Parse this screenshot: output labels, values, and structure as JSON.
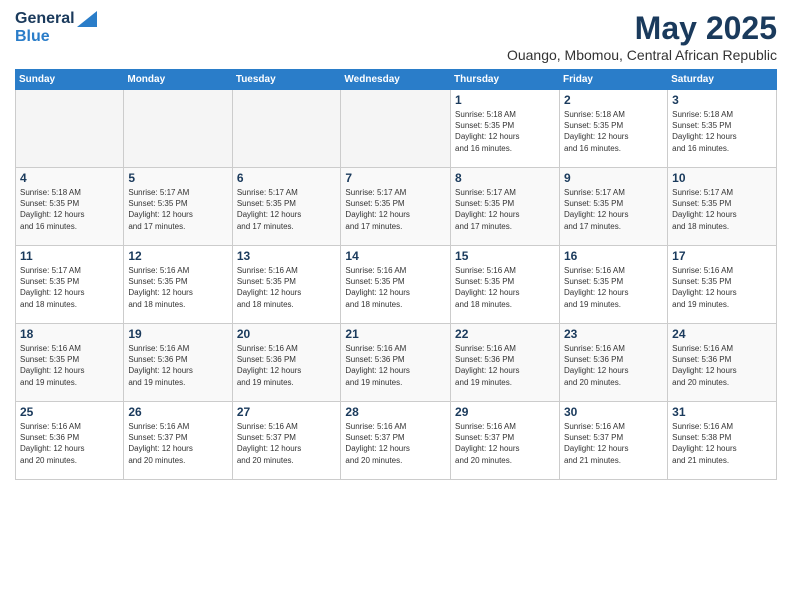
{
  "logo": {
    "general": "General",
    "blue": "Blue"
  },
  "header": {
    "month": "May 2025",
    "subtitle": "Ouango, Mbomou, Central African Republic"
  },
  "weekdays": [
    "Sunday",
    "Monday",
    "Tuesday",
    "Wednesday",
    "Thursday",
    "Friday",
    "Saturday"
  ],
  "weeks": [
    [
      {
        "day": "",
        "info": ""
      },
      {
        "day": "",
        "info": ""
      },
      {
        "day": "",
        "info": ""
      },
      {
        "day": "",
        "info": ""
      },
      {
        "day": "1",
        "info": "Sunrise: 5:18 AM\nSunset: 5:35 PM\nDaylight: 12 hours\nand 16 minutes."
      },
      {
        "day": "2",
        "info": "Sunrise: 5:18 AM\nSunset: 5:35 PM\nDaylight: 12 hours\nand 16 minutes."
      },
      {
        "day": "3",
        "info": "Sunrise: 5:18 AM\nSunset: 5:35 PM\nDaylight: 12 hours\nand 16 minutes."
      }
    ],
    [
      {
        "day": "4",
        "info": "Sunrise: 5:18 AM\nSunset: 5:35 PM\nDaylight: 12 hours\nand 16 minutes."
      },
      {
        "day": "5",
        "info": "Sunrise: 5:17 AM\nSunset: 5:35 PM\nDaylight: 12 hours\nand 17 minutes."
      },
      {
        "day": "6",
        "info": "Sunrise: 5:17 AM\nSunset: 5:35 PM\nDaylight: 12 hours\nand 17 minutes."
      },
      {
        "day": "7",
        "info": "Sunrise: 5:17 AM\nSunset: 5:35 PM\nDaylight: 12 hours\nand 17 minutes."
      },
      {
        "day": "8",
        "info": "Sunrise: 5:17 AM\nSunset: 5:35 PM\nDaylight: 12 hours\nand 17 minutes."
      },
      {
        "day": "9",
        "info": "Sunrise: 5:17 AM\nSunset: 5:35 PM\nDaylight: 12 hours\nand 17 minutes."
      },
      {
        "day": "10",
        "info": "Sunrise: 5:17 AM\nSunset: 5:35 PM\nDaylight: 12 hours\nand 18 minutes."
      }
    ],
    [
      {
        "day": "11",
        "info": "Sunrise: 5:17 AM\nSunset: 5:35 PM\nDaylight: 12 hours\nand 18 minutes."
      },
      {
        "day": "12",
        "info": "Sunrise: 5:16 AM\nSunset: 5:35 PM\nDaylight: 12 hours\nand 18 minutes."
      },
      {
        "day": "13",
        "info": "Sunrise: 5:16 AM\nSunset: 5:35 PM\nDaylight: 12 hours\nand 18 minutes."
      },
      {
        "day": "14",
        "info": "Sunrise: 5:16 AM\nSunset: 5:35 PM\nDaylight: 12 hours\nand 18 minutes."
      },
      {
        "day": "15",
        "info": "Sunrise: 5:16 AM\nSunset: 5:35 PM\nDaylight: 12 hours\nand 18 minutes."
      },
      {
        "day": "16",
        "info": "Sunrise: 5:16 AM\nSunset: 5:35 PM\nDaylight: 12 hours\nand 19 minutes."
      },
      {
        "day": "17",
        "info": "Sunrise: 5:16 AM\nSunset: 5:35 PM\nDaylight: 12 hours\nand 19 minutes."
      }
    ],
    [
      {
        "day": "18",
        "info": "Sunrise: 5:16 AM\nSunset: 5:35 PM\nDaylight: 12 hours\nand 19 minutes."
      },
      {
        "day": "19",
        "info": "Sunrise: 5:16 AM\nSunset: 5:36 PM\nDaylight: 12 hours\nand 19 minutes."
      },
      {
        "day": "20",
        "info": "Sunrise: 5:16 AM\nSunset: 5:36 PM\nDaylight: 12 hours\nand 19 minutes."
      },
      {
        "day": "21",
        "info": "Sunrise: 5:16 AM\nSunset: 5:36 PM\nDaylight: 12 hours\nand 19 minutes."
      },
      {
        "day": "22",
        "info": "Sunrise: 5:16 AM\nSunset: 5:36 PM\nDaylight: 12 hours\nand 19 minutes."
      },
      {
        "day": "23",
        "info": "Sunrise: 5:16 AM\nSunset: 5:36 PM\nDaylight: 12 hours\nand 20 minutes."
      },
      {
        "day": "24",
        "info": "Sunrise: 5:16 AM\nSunset: 5:36 PM\nDaylight: 12 hours\nand 20 minutes."
      }
    ],
    [
      {
        "day": "25",
        "info": "Sunrise: 5:16 AM\nSunset: 5:36 PM\nDaylight: 12 hours\nand 20 minutes."
      },
      {
        "day": "26",
        "info": "Sunrise: 5:16 AM\nSunset: 5:37 PM\nDaylight: 12 hours\nand 20 minutes."
      },
      {
        "day": "27",
        "info": "Sunrise: 5:16 AM\nSunset: 5:37 PM\nDaylight: 12 hours\nand 20 minutes."
      },
      {
        "day": "28",
        "info": "Sunrise: 5:16 AM\nSunset: 5:37 PM\nDaylight: 12 hours\nand 20 minutes."
      },
      {
        "day": "29",
        "info": "Sunrise: 5:16 AM\nSunset: 5:37 PM\nDaylight: 12 hours\nand 20 minutes."
      },
      {
        "day": "30",
        "info": "Sunrise: 5:16 AM\nSunset: 5:37 PM\nDaylight: 12 hours\nand 21 minutes."
      },
      {
        "day": "31",
        "info": "Sunrise: 5:16 AM\nSunset: 5:38 PM\nDaylight: 12 hours\nand 21 minutes."
      }
    ]
  ]
}
